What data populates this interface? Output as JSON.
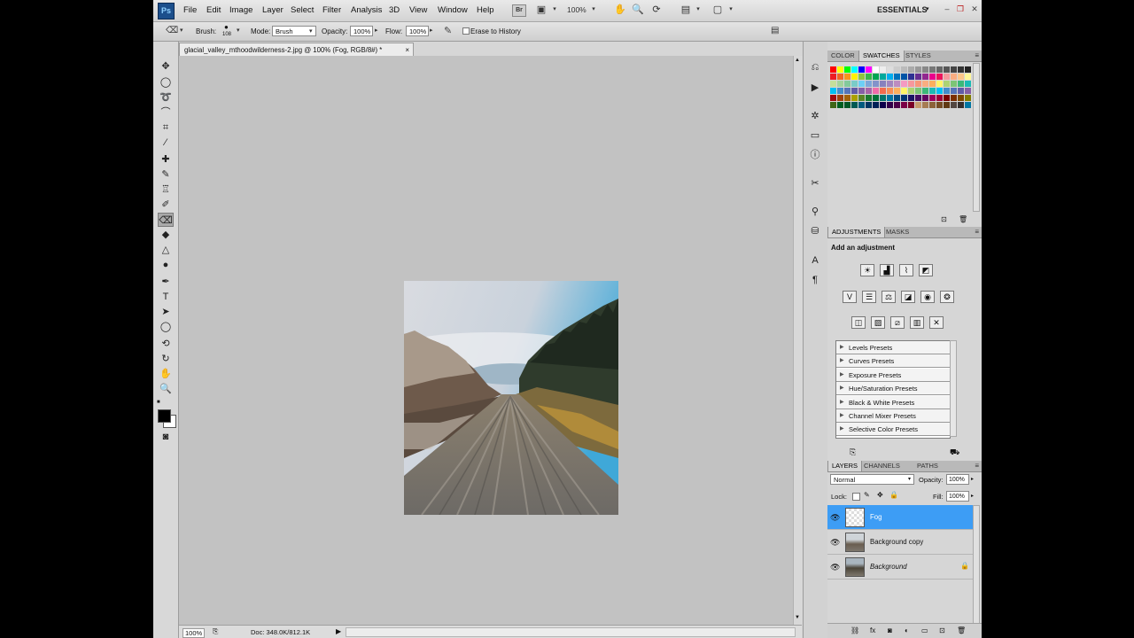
{
  "app": {
    "logo": "Ps",
    "menu": [
      "File",
      "Edit",
      "Image",
      "Layer",
      "Select",
      "Filter",
      "Analysis",
      "3D",
      "View",
      "Window",
      "Help"
    ],
    "bridge_button": "Br",
    "zoom_dropdown": "100%",
    "workspace": "ESSENTIALS"
  },
  "options": {
    "brush_label": "Brush:",
    "brush_size": "108",
    "mode_label": "Mode:",
    "mode_value": "Brush",
    "opacity_label": "Opacity:",
    "opacity_value": "100%",
    "flow_label": "Flow:",
    "flow_value": "100%",
    "erase_history_label": "Erase to History"
  },
  "document": {
    "tab_title": "glacial_valley_mthoodwilderness-2.jpg @ 100% (Fog, RGB/8#) *",
    "close": "×",
    "zoom": "100%",
    "doc_info": "Doc: 348.0K/812.1K"
  },
  "panels": {
    "color_tabs": [
      "COLOR",
      "SWATCHES",
      "STYLES"
    ],
    "adjust_tabs": [
      "ADJUSTMENTS",
      "MASKS"
    ],
    "adjust_title": "Add an adjustment",
    "presets": [
      "Levels Presets",
      "Curves Presets",
      "Exposure Presets",
      "Hue/Saturation Presets",
      "Black & White Presets",
      "Channel Mixer Presets",
      "Selective Color Presets"
    ],
    "layer_tabs": [
      "LAYERS",
      "CHANNELS",
      "PATHS"
    ],
    "blend_mode": "Normal",
    "opacity_label": "Opacity:",
    "opacity_value": "100%",
    "lock_label": "Lock:",
    "fill_label": "Fill:",
    "fill_value": "100%",
    "layers": [
      {
        "name": "Fog",
        "selected": true
      },
      {
        "name": "Background copy",
        "selected": false
      },
      {
        "name": "Background",
        "selected": false
      }
    ]
  },
  "swatch_colors": {
    "row1": [
      "#ff0000",
      "#ffff00",
      "#00ff00",
      "#00ffff",
      "#0000ff",
      "#ff00ff",
      "#ffffff",
      "#eeeeee",
      "#dddddd",
      "#cccccc",
      "#bbbbbb",
      "#aaaaaa",
      "#999999",
      "#888888",
      "#777777",
      "#666666",
      "#555555",
      "#444444",
      "#333333",
      "#222222"
    ],
    "row2": [
      "#ed1c24",
      "#f26522",
      "#f7941d",
      "#fff200",
      "#8dc63f",
      "#39b54a",
      "#00a651",
      "#00a99d",
      "#00aeef",
      "#0072bc",
      "#0054a6",
      "#2e3192",
      "#662d91",
      "#92278f",
      "#ec008c",
      "#ed145b",
      "#f5989d",
      "#f9ad81",
      "#fdc689",
      "#fff799"
    ],
    "row3": [
      "#c4df9b",
      "#a3d39c",
      "#82ca9c",
      "#7accc8",
      "#6dcff6",
      "#7da7d9",
      "#8393ca",
      "#8781bd",
      "#a186be",
      "#bd8cbf",
      "#f49ac1",
      "#f6989d",
      "#f7977a",
      "#f9ad81",
      "#fbaf5d",
      "#fff568",
      "#acd373",
      "#7cc576",
      "#3bb878",
      "#1abbb4"
    ],
    "row4": [
      "#00bff3",
      "#448ccb",
      "#5674b9",
      "#605ca8",
      "#8560a8",
      "#a864a8",
      "#f06eaa",
      "#f26c4f",
      "#f68e56",
      "#fbaf5d",
      "#fff467",
      "#acd372",
      "#7cc576",
      "#3cb878",
      "#1cbbb4",
      "#00bff3",
      "#438ccb",
      "#5574b9",
      "#605ca8",
      "#8560a8"
    ],
    "row5": [
      "#9e0b0f",
      "#a0410d",
      "#a36209",
      "#aba000",
      "#598527",
      "#1a7b30",
      "#007236",
      "#00746b",
      "#0076a3",
      "#004a80",
      "#003471",
      "#1b1464",
      "#440e62",
      "#630460",
      "#9e005d",
      "#9e0039",
      "#790000",
      "#7b2e00",
      "#7d4900",
      "#827b00"
    ],
    "row6": [
      "#406618",
      "#005e20",
      "#005826",
      "#005952",
      "#005b7f",
      "#003663",
      "#002157",
      "#0d004c",
      "#32004b",
      "#4b0049",
      "#7b0046",
      "#7a0026",
      "#c69c6d",
      "#a67c52",
      "#8c6239",
      "#754c24",
      "#603913",
      "#534741",
      "#362f2d",
      "#0076a3"
    ]
  }
}
